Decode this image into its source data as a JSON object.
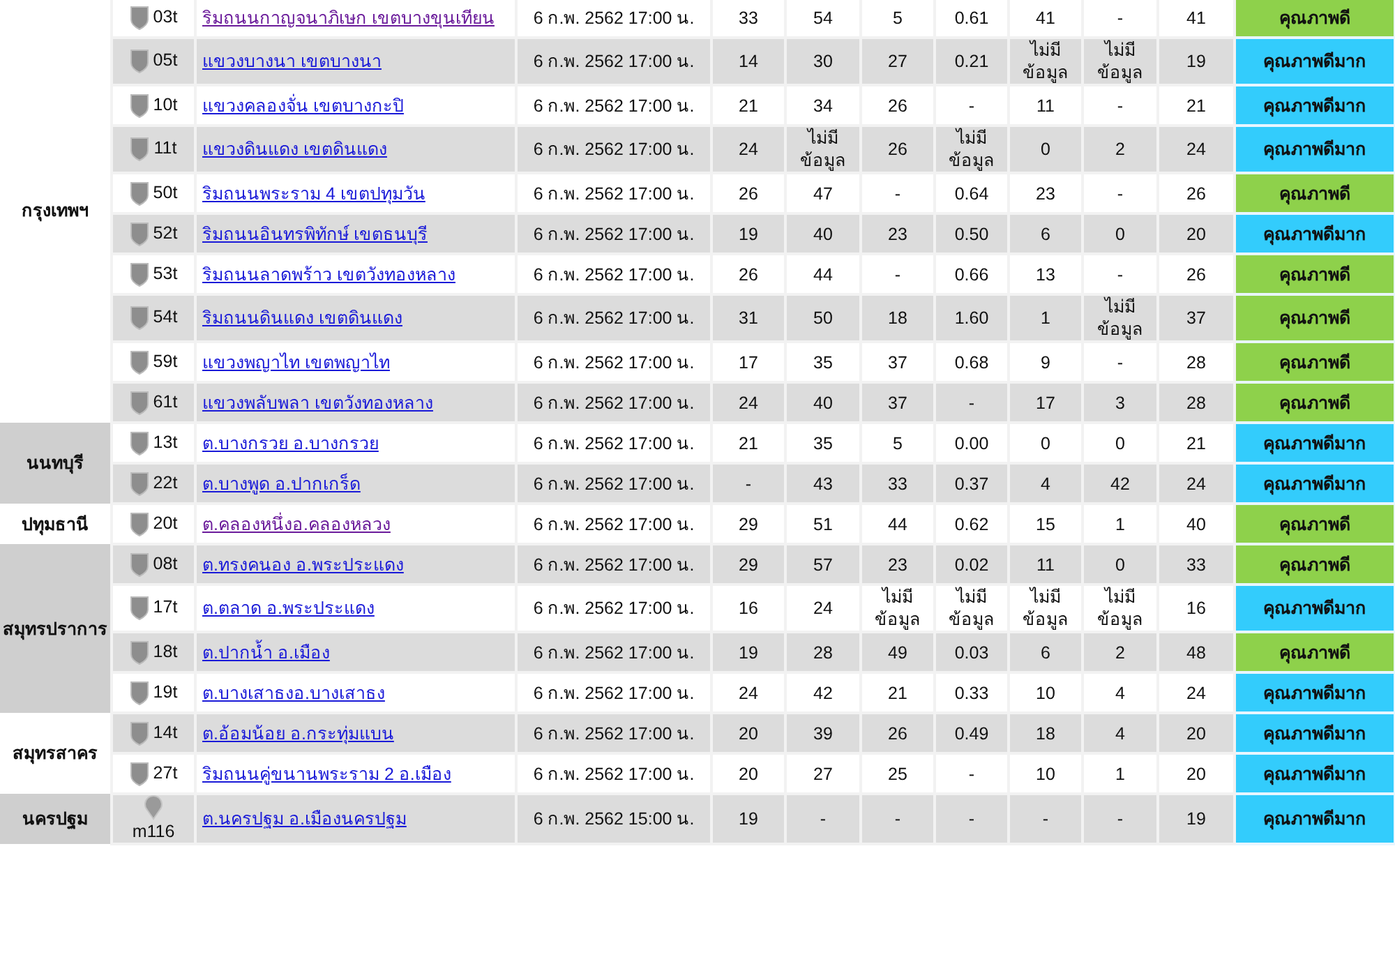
{
  "groups": [
    {
      "province": "กรุงเทพฯ",
      "rows": [
        {
          "kind": "shield",
          "id": "03t",
          "name": "ริมถนนกาญจนาภิเษก เขตบางขุนเทียน",
          "visited": true,
          "time": "6 ก.พ. 2562 17:00 น.",
          "values": [
            "33",
            "54",
            "5",
            "0.61",
            "41",
            "-",
            "41"
          ],
          "quality": {
            "label": "คุณภาพดี",
            "color": "#8ed14b"
          }
        },
        {
          "kind": "shield",
          "id": "05t",
          "name": "แขวงบางนา เขตบางนา",
          "visited": false,
          "time": "6 ก.พ. 2562 17:00 น.",
          "values": [
            "14",
            "30",
            "27",
            "0.21",
            "ไม่มี ข้อมูล",
            "ไม่มี ข้อมูล",
            "19"
          ],
          "quality": {
            "label": "คุณภาพดีมาก",
            "color": "#33ccfc"
          }
        },
        {
          "kind": "shield",
          "id": "10t",
          "name": "แขวงคลองจั่น เขตบางกะปิ",
          "visited": false,
          "time": "6 ก.พ. 2562 17:00 น.",
          "values": [
            "21",
            "34",
            "26",
            "-",
            "11",
            "-",
            "21"
          ],
          "quality": {
            "label": "คุณภาพดีมาก",
            "color": "#33ccfc"
          }
        },
        {
          "kind": "shield",
          "id": "11t",
          "name": "แขวงดินแดง เขตดินแดง",
          "visited": false,
          "time": "6 ก.พ. 2562 17:00 น.",
          "values": [
            "24",
            "ไม่มี ข้อมูล",
            "26",
            "ไม่มี ข้อมูล",
            "0",
            "2",
            "24"
          ],
          "quality": {
            "label": "คุณภาพดีมาก",
            "color": "#33ccfc"
          }
        },
        {
          "kind": "shield",
          "id": "50t",
          "name": "ริมถนนพระราม 4 เขตปทุมวัน",
          "visited": false,
          "time": "6 ก.พ. 2562 17:00 น.",
          "values": [
            "26",
            "47",
            "-",
            "0.64",
            "23",
            "-",
            "26"
          ],
          "quality": {
            "label": "คุณภาพดี",
            "color": "#8ed14b"
          }
        },
        {
          "kind": "shield",
          "id": "52t",
          "name": "ริมถนนอินทรพิทักษ์ เขตธนบุรี",
          "visited": false,
          "time": "6 ก.พ. 2562 17:00 น.",
          "values": [
            "19",
            "40",
            "23",
            "0.50",
            "6",
            "0",
            "20"
          ],
          "quality": {
            "label": "คุณภาพดีมาก",
            "color": "#33ccfc"
          }
        },
        {
          "kind": "shield",
          "id": "53t",
          "name": "ริมถนนลาดพร้าว เขตวังทองหลาง",
          "visited": false,
          "time": "6 ก.พ. 2562 17:00 น.",
          "values": [
            "26",
            "44",
            "-",
            "0.66",
            "13",
            "-",
            "26"
          ],
          "quality": {
            "label": "คุณภาพดี",
            "color": "#8ed14b"
          }
        },
        {
          "kind": "shield",
          "id": "54t",
          "name": "ริมถนนดินแดง เขตดินแดง",
          "visited": false,
          "time": "6 ก.พ. 2562 17:00 น.",
          "values": [
            "31",
            "50",
            "18",
            "1.60",
            "1",
            "ไม่มี ข้อมูล",
            "37"
          ],
          "quality": {
            "label": "คุณภาพดี",
            "color": "#8ed14b"
          }
        },
        {
          "kind": "shield",
          "id": "59t",
          "name": "แขวงพญาไท เขตพญาไท",
          "visited": false,
          "time": "6 ก.พ. 2562 17:00 น.",
          "values": [
            "17",
            "35",
            "37",
            "0.68",
            "9",
            "-",
            "28"
          ],
          "quality": {
            "label": "คุณภาพดี",
            "color": "#8ed14b"
          }
        },
        {
          "kind": "shield",
          "id": "61t",
          "name": "แขวงพลับพลา เขตวังทองหลาง",
          "visited": false,
          "time": "6 ก.พ. 2562 17:00 น.",
          "values": [
            "24",
            "40",
            "37",
            "-",
            "17",
            "3",
            "28"
          ],
          "quality": {
            "label": "คุณภาพดี",
            "color": "#8ed14b"
          }
        }
      ]
    },
    {
      "province": "นนทบุรี",
      "rows": [
        {
          "kind": "shield",
          "id": "13t",
          "name": "ต.บางกรวย อ.บางกรวย",
          "visited": false,
          "time": "6 ก.พ. 2562 17:00 น.",
          "values": [
            "21",
            "35",
            "5",
            "0.00",
            "0",
            "0",
            "21"
          ],
          "quality": {
            "label": "คุณภาพดีมาก",
            "color": "#33ccfc"
          }
        },
        {
          "kind": "shield",
          "id": "22t",
          "name": "ต.บางพูด อ.ปากเกร็ด",
          "visited": false,
          "time": "6 ก.พ. 2562 17:00 น.",
          "values": [
            "-",
            "43",
            "33",
            "0.37",
            "4",
            "42",
            "24"
          ],
          "quality": {
            "label": "คุณภาพดีมาก",
            "color": "#33ccfc"
          }
        }
      ]
    },
    {
      "province": "ปทุมธานี",
      "rows": [
        {
          "kind": "shield",
          "id": "20t",
          "name": "ต.คลองหนึ่งอ.คลองหลวง",
          "visited": true,
          "time": "6 ก.พ. 2562 17:00 น.",
          "values": [
            "29",
            "51",
            "44",
            "0.62",
            "15",
            "1",
            "40"
          ],
          "quality": {
            "label": "คุณภาพดี",
            "color": "#8ed14b"
          }
        }
      ]
    },
    {
      "province": "สมุทรปราการ",
      "rows": [
        {
          "kind": "shield",
          "id": "08t",
          "name": "ต.ทรงคนอง อ.พระประแดง",
          "visited": false,
          "time": "6 ก.พ. 2562 17:00 น.",
          "values": [
            "29",
            "57",
            "23",
            "0.02",
            "11",
            "0",
            "33"
          ],
          "quality": {
            "label": "คุณภาพดี",
            "color": "#8ed14b"
          }
        },
        {
          "kind": "shield",
          "id": "17t",
          "name": "ต.ตลาด อ.พระประแดง",
          "visited": false,
          "time": "6 ก.พ. 2562 17:00 น.",
          "values": [
            "16",
            "24",
            "ไม่มี ข้อมูล",
            "ไม่มี ข้อมูล",
            "ไม่มี ข้อมูล",
            "ไม่มี ข้อมูล",
            "16"
          ],
          "quality": {
            "label": "คุณภาพดีมาก",
            "color": "#33ccfc"
          }
        },
        {
          "kind": "shield",
          "id": "18t",
          "name": "ต.ปากน้ำ อ.เมือง",
          "visited": false,
          "time": "6 ก.พ. 2562 17:00 น.",
          "values": [
            "19",
            "28",
            "49",
            "0.03",
            "6",
            "2",
            "48"
          ],
          "quality": {
            "label": "คุณภาพดี",
            "color": "#8ed14b"
          }
        },
        {
          "kind": "shield",
          "id": "19t",
          "name": "ต.บางเสาธงอ.บางเสาธง",
          "visited": false,
          "time": "6 ก.พ. 2562 17:00 น.",
          "values": [
            "24",
            "42",
            "21",
            "0.33",
            "10",
            "4",
            "24"
          ],
          "quality": {
            "label": "คุณภาพดีมาก",
            "color": "#33ccfc"
          }
        }
      ]
    },
    {
      "province": "สมุทรสาคร",
      "rows": [
        {
          "kind": "shield",
          "id": "14t",
          "name": "ต.อ้อมน้อย อ.กระทุ่มแบน",
          "visited": false,
          "time": "6 ก.พ. 2562 17:00 น.",
          "values": [
            "20",
            "39",
            "26",
            "0.49",
            "18",
            "4",
            "20"
          ],
          "quality": {
            "label": "คุณภาพดีมาก",
            "color": "#33ccfc"
          }
        },
        {
          "kind": "shield",
          "id": "27t",
          "name": "ริมถนนคู่ขนานพระราม 2 อ.เมือง",
          "visited": false,
          "time": "6 ก.พ. 2562 17:00 น.",
          "values": [
            "20",
            "27",
            "25",
            "-",
            "10",
            "1",
            "20"
          ],
          "quality": {
            "label": "คุณภาพดีมาก",
            "color": "#33ccfc"
          }
        }
      ]
    },
    {
      "province": "นครปฐม",
      "rows": [
        {
          "kind": "pin",
          "id": "m116",
          "name": "ต.นครปฐม อ.เมืองนครปฐม",
          "visited": false,
          "time": "6 ก.พ. 2562 15:00 น.",
          "values": [
            "19",
            "-",
            "-",
            "-",
            "-",
            "-",
            "19"
          ],
          "quality": {
            "label": "คุณภาพดีมาก",
            "color": "#33ccfc"
          }
        }
      ]
    }
  ]
}
